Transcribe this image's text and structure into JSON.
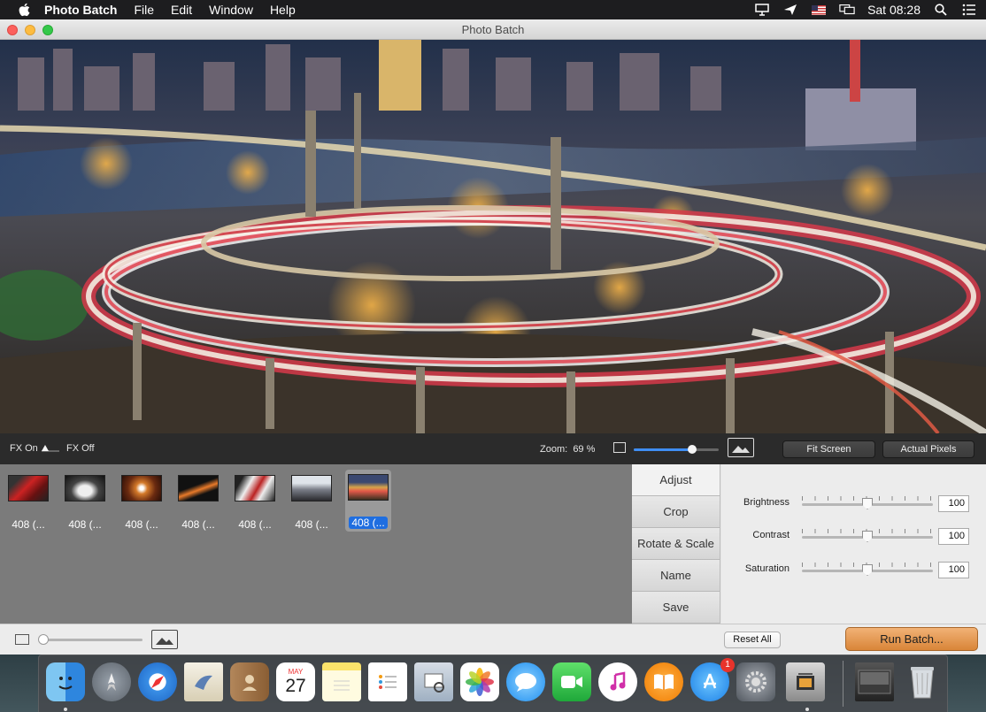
{
  "menubar": {
    "app_name": "Photo Batch",
    "items": [
      "File",
      "Edit",
      "Window",
      "Help"
    ],
    "clock": "Sat 08:28"
  },
  "window": {
    "title": "Photo Batch"
  },
  "controls": {
    "fx_on": "FX On",
    "fx_off": "FX Off",
    "zoom_label": "Zoom:",
    "zoom_value": "69 %",
    "zoom_fraction": 0.69,
    "fit_screen": "Fit Screen",
    "actual_pixels": "Actual Pixels"
  },
  "thumbnails": [
    {
      "label": "408 (...",
      "selected": false
    },
    {
      "label": "408 (...",
      "selected": false
    },
    {
      "label": "408 (...",
      "selected": false
    },
    {
      "label": "408 (...",
      "selected": false
    },
    {
      "label": "408 (...",
      "selected": false
    },
    {
      "label": "408 (...",
      "selected": false
    },
    {
      "label": "408 (...",
      "selected": true
    }
  ],
  "thumbnail_size_fraction": 0.0,
  "tabs": [
    "Adjust",
    "Crop",
    "Rotate & Scale",
    "Name",
    "Save"
  ],
  "active_tab": "Adjust",
  "adjustments": [
    {
      "label": "Brightness",
      "value": "100",
      "fraction": 0.5
    },
    {
      "label": "Contrast",
      "value": "100",
      "fraction": 0.5
    },
    {
      "label": "Saturation",
      "value": "100",
      "fraction": 0.5
    }
  ],
  "buttons": {
    "reset_all": "Reset All",
    "run_batch": "Run Batch..."
  },
  "dock": {
    "calendar_month": "MAY",
    "calendar_day": "27",
    "app_store_badge": "1",
    "accent": "#1f6ee0"
  }
}
